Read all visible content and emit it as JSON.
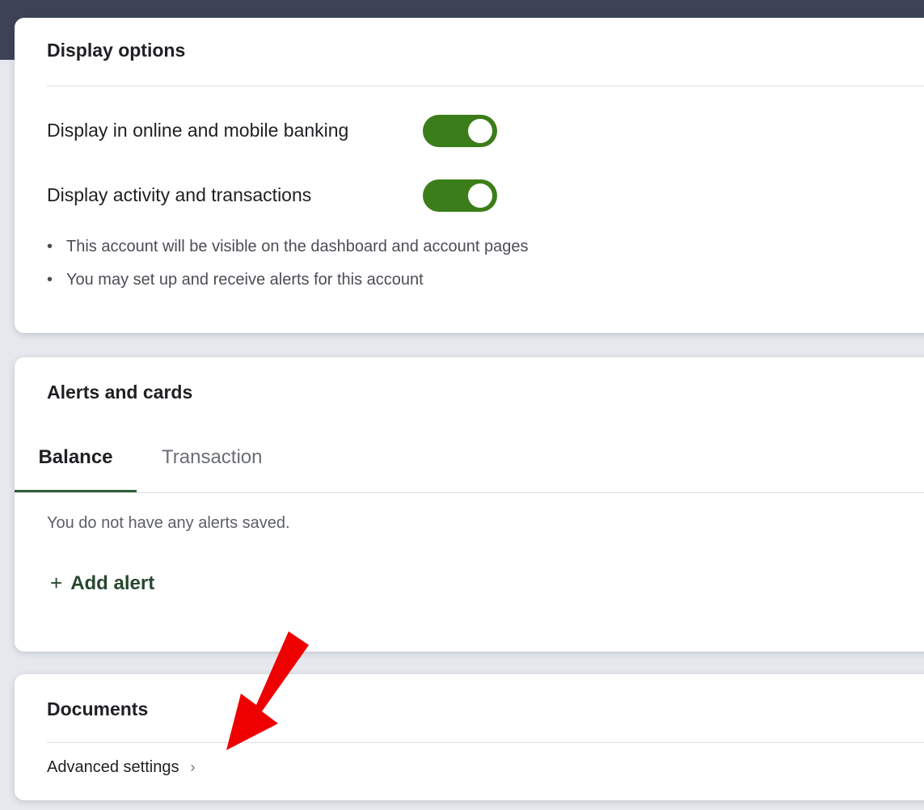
{
  "display_options": {
    "title": "Display options",
    "settings": [
      {
        "label": "Display in online and mobile banking",
        "enabled": true
      },
      {
        "label": "Display activity and transactions",
        "enabled": true
      }
    ],
    "notes": [
      "This account will be visible on the dashboard and account pages",
      "You may set up and receive alerts for this account"
    ]
  },
  "alerts": {
    "title": "Alerts and cards",
    "tabs": [
      {
        "label": "Balance",
        "active": true
      },
      {
        "label": "Transaction",
        "active": false
      }
    ],
    "empty_message": "You do not have any alerts saved.",
    "add_label": "Add alert",
    "add_icon": "+"
  },
  "documents": {
    "title": "Documents",
    "advanced_label": "Advanced settings",
    "chevron": "›"
  },
  "colors": {
    "toggle_on": "#3b7d1a",
    "header_band": "#3d4357",
    "accent_green": "#2e5f3a",
    "annotation_arrow": "#ee0000"
  }
}
